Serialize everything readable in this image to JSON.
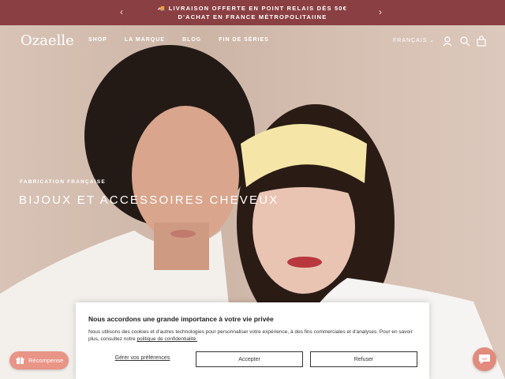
{
  "announcement": {
    "text": "🚚 LIVRAISON OFFERTE EN POINT RELAIS DÈS 50€ D'ACHAT EN FRANCE MÉTROPOLITAIINE",
    "prev": "‹",
    "next": "›"
  },
  "header": {
    "logo": "Ozaelle",
    "nav": [
      "SHOP",
      "LA MARQUE",
      "BLOG",
      "FIN DE SÉRIES"
    ],
    "language": "FRANÇAIS"
  },
  "hero": {
    "subtitle": "FABRICATION FRANÇAISE",
    "title": "BIJOUX ET ACCESSOIRES CHEVEUX"
  },
  "cookie": {
    "title": "Nous accordons une grande importance à votre vie privée",
    "text": "Nous utilisons des cookies et d'autres technologies pour personnaliser votre expérience, à des fins commerciales et d'analyses. Pour en savoir plus, consultez notre",
    "link": "politique de confidentialité.",
    "manage": "Gérer vos préférences",
    "accept": "Accepter",
    "refuse": "Refuser"
  },
  "reward": {
    "label": "Récompense"
  },
  "colors": {
    "announce_bg": "#8a3f42",
    "accent": "#e89486"
  }
}
